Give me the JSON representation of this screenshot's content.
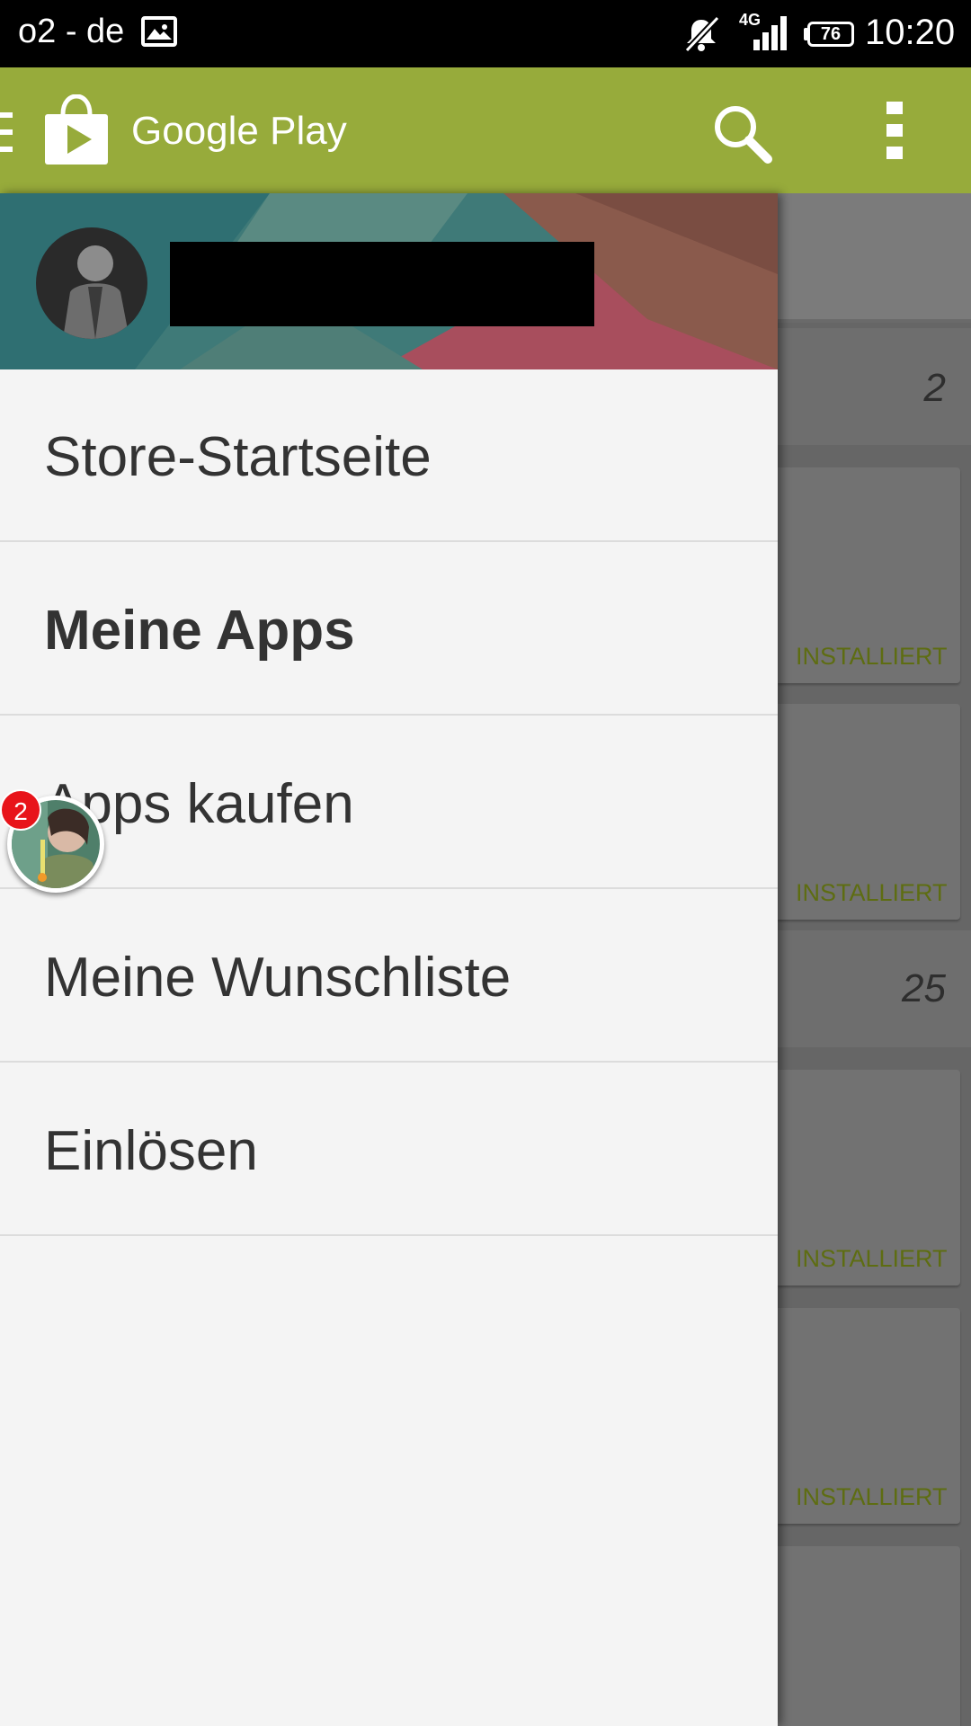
{
  "status_bar": {
    "carrier": "o2 - de",
    "network": "4G",
    "battery": "76",
    "time": "10:20"
  },
  "app_bar": {
    "title": "Google Play",
    "icons": [
      "menu-icon",
      "play-store-logo",
      "search-icon",
      "overflow-menu-icon"
    ],
    "color": "#97ab3b"
  },
  "drawer": {
    "items": [
      {
        "label": "Store-Startseite",
        "active": false
      },
      {
        "label": "Meine Apps",
        "active": true
      },
      {
        "label": "Apps kaufen",
        "active": false
      },
      {
        "label": "Meine Wunschliste",
        "active": false
      },
      {
        "label": "Einlösen",
        "active": false
      }
    ]
  },
  "background_list": {
    "section_counts": [
      "2",
      "25"
    ],
    "item_status": [
      "INSTALLIERT",
      "INSTALLIERT",
      "INSTALLIERT",
      "INSTALLIERT"
    ],
    "status_color": "#5e6d12"
  },
  "chat_head": {
    "badge_count": "2"
  }
}
